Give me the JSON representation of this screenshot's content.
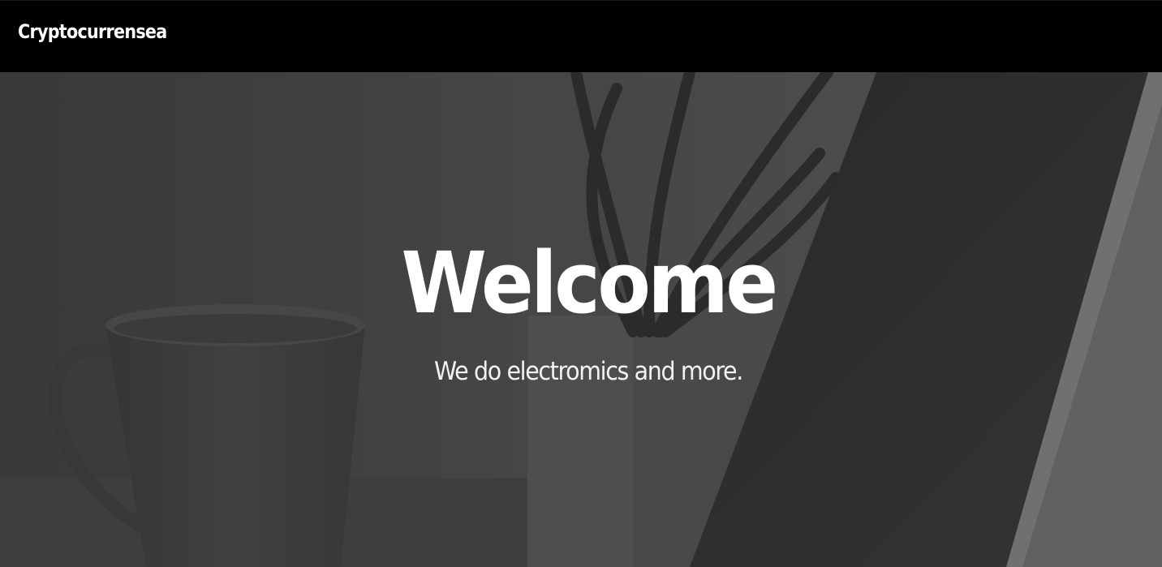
{
  "navbar": {
    "brand": "Cryptocurrensea"
  },
  "hero": {
    "title": "Welcome",
    "subtitle": "We do electromics and more."
  },
  "colors": {
    "navbar_bg": "#000000",
    "text": "#ffffff",
    "hero_overlay": "#4a4a4a"
  }
}
